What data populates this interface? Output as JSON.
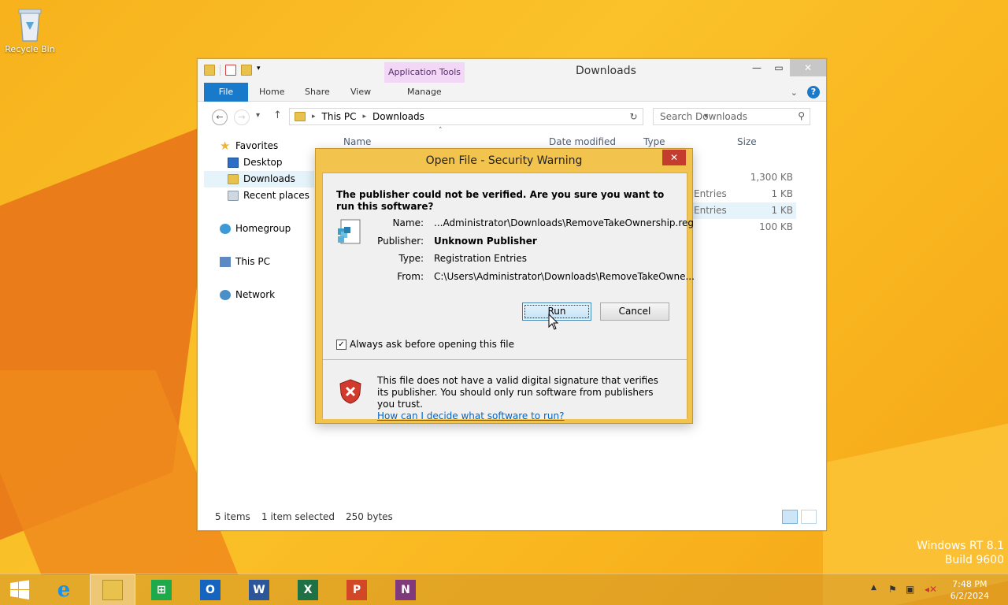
{
  "desktop": {
    "recycle_bin_label": "Recycle Bin",
    "watermark_line1": "Windows RT 8.1",
    "watermark_line2": "Build 9600"
  },
  "explorer": {
    "title": "Downloads",
    "contextual_tab": "Application Tools",
    "tabs": [
      "File",
      "Home",
      "Share",
      "View",
      "Manage"
    ],
    "breadcrumb": [
      "This PC",
      "Downloads"
    ],
    "search_placeholder": "Search Downloads",
    "columns": {
      "name": "Name",
      "date": "Date modified",
      "type": "Type",
      "size": "Size"
    },
    "nav": {
      "favorites": "Favorites",
      "desktop": "Desktop",
      "downloads": "Downloads",
      "recent": "Recent places",
      "homegroup": "Homegroup",
      "this_pc": "This PC",
      "network": "Network"
    },
    "rows": [
      {
        "type": "",
        "size": "1,300 KB"
      },
      {
        "type": "Entries",
        "size": "1 KB"
      },
      {
        "type": "Entries",
        "size": "1 KB"
      },
      {
        "type": "",
        "size": "100 KB"
      }
    ],
    "status": {
      "items": "5 items",
      "selected": "1 item selected",
      "bytes": "250 bytes"
    }
  },
  "dialog": {
    "title": "Open File - Security Warning",
    "question": "The publisher could not be verified.  Are you sure you want to run this software?",
    "fields": {
      "name_label": "Name:",
      "name_value": "...Administrator\\Downloads\\RemoveTakeOwnership.reg",
      "publisher_label": "Publisher:",
      "publisher_value": "Unknown Publisher",
      "type_label": "Type:",
      "type_value": "Registration Entries",
      "from_label": "From:",
      "from_value": "C:\\Users\\Administrator\\Downloads\\RemoveTakeOwne..."
    },
    "run_label": "Run",
    "cancel_label": "Cancel",
    "checkbox_label": "Always ask before opening this file",
    "checkbox_checked": true,
    "warning_text": "This file does not have a valid digital signature that verifies its publisher.  You should only run software from publishers you trust.",
    "help_link": "How can I decide what software to run?"
  },
  "taskbar": {
    "apps": [
      "start-icon",
      "internet-explorer-icon",
      "file-explorer-icon",
      "store-icon",
      "outlook-icon",
      "word-icon",
      "excel-icon",
      "powerpoint-icon",
      "onenote-icon"
    ],
    "time": "7:48 PM",
    "date": "6/2/2024"
  }
}
